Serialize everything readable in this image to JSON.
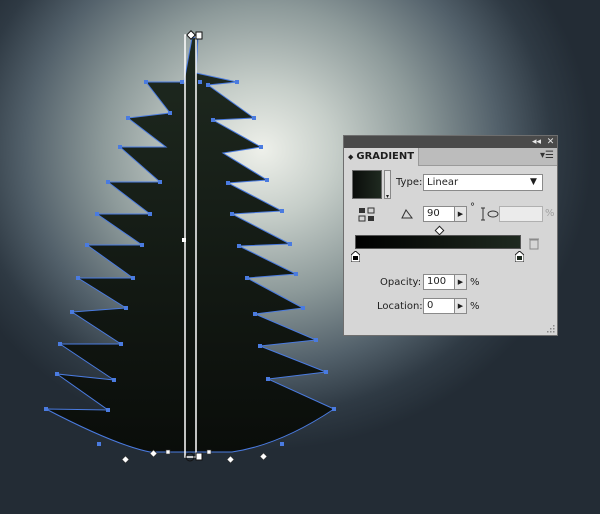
{
  "panel": {
    "tab_label": "GRADIENT",
    "type_label": "Type:",
    "type_value": "Linear",
    "angle_value": "90",
    "angle_unit": "°",
    "aspect_unit": "%",
    "opacity_label": "Opacity:",
    "opacity_value": "100",
    "opacity_unit": "%",
    "location_label": "Location:",
    "location_value": "0",
    "location_unit": "%",
    "gradient_start_color": "#000000",
    "gradient_end_color": "#1f2a20"
  },
  "artwork": {
    "tree_fill": "#141a14",
    "path_color": "#4a7be0"
  }
}
